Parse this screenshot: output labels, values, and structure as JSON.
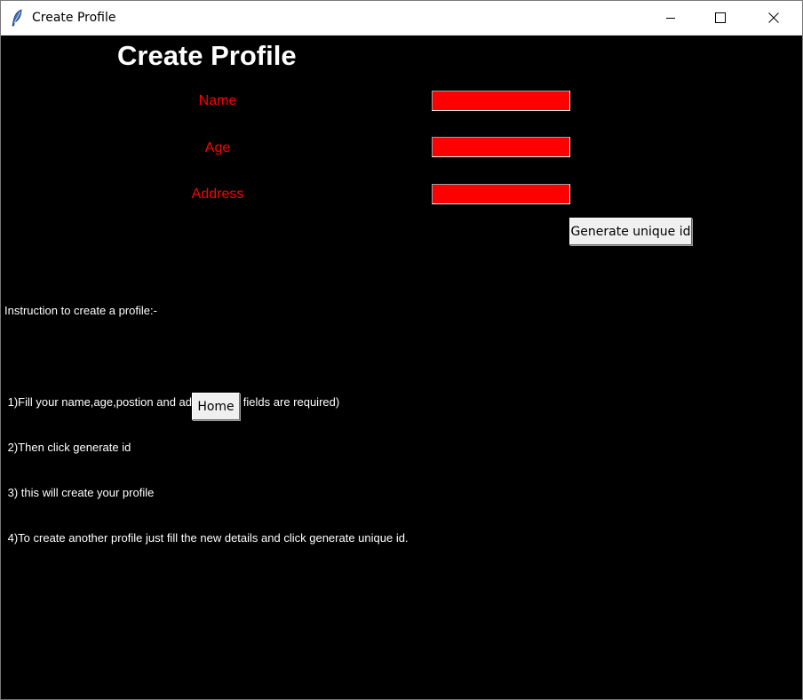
{
  "window": {
    "title": "Create Profile",
    "controls": {
      "minimize_icon": "minimize-icon",
      "maximize_icon": "maximize-icon",
      "close_icon": "close-icon"
    },
    "app_icon": "feather-icon"
  },
  "form": {
    "heading": "Create Profile",
    "fields": [
      {
        "label": "Name",
        "value": ""
      },
      {
        "label": "Age",
        "value": ""
      },
      {
        "label": "Address",
        "value": ""
      }
    ],
    "generate_button": "Generate unique id"
  },
  "instructions": {
    "heading": "Instruction to create a profile:-",
    "steps": [
      " 1)Fill your name,age,postion and address.(All fields are required)",
      " 2)Then click generate id",
      " 3) this will create your profile",
      " 4)To create another profile just fill the new details and click generate unique id."
    ]
  },
  "home_button": "Home",
  "colors": {
    "background": "#000000",
    "label_text": "#ff0000",
    "input_background": "#ff0000",
    "heading_text": "#ffffff",
    "button_face": "#f0f0f0"
  }
}
